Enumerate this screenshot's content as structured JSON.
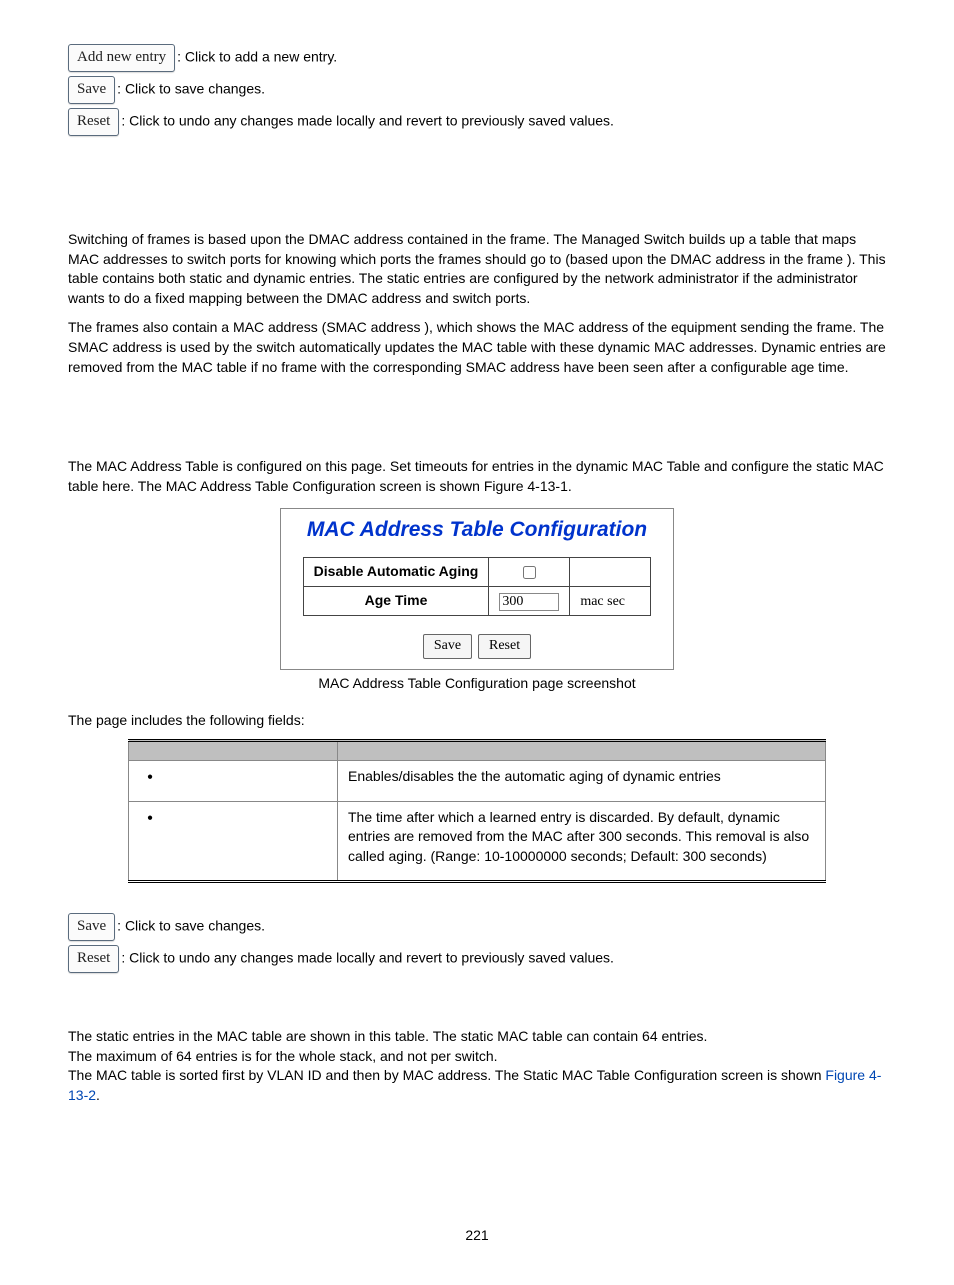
{
  "top_buttons": {
    "add_label": "Add new entry",
    "add_desc": ": Click to add a new entry.",
    "save_label": "Save",
    "save_desc": ": Click to save changes.",
    "reset_label": "Reset",
    "reset_desc": ": Click to undo any changes made locally and revert to previously saved values."
  },
  "para1": "Switching of frames is based upon the DMAC address contained in the frame. The Managed Switch builds up a table that maps MAC addresses to switch ports for knowing which ports the frames should go to (based upon the DMAC address in the frame ). This table contains both static and dynamic entries. The static entries are configured by the network administrator if the administrator wants to do a fixed mapping between the DMAC address and switch ports.",
  "para2": "The frames also contain a MAC address (SMAC address ), which shows the MAC address of the equipment sending the frame. The SMAC address is used by the switch automatically updates the MAC table with these dynamic MAC addresses. Dynamic entries are removed from the MAC table if no frame with the corresponding SMAC address have been seen after a configurable age time.",
  "para3": "The MAC Address Table is configured on this page. Set timeouts for entries in the dynamic MAC Table and configure the static MAC table here. The MAC Address Table Configuration screen is shown Figure 4-13-1.",
  "figure": {
    "title": "MAC Address Table Configuration",
    "row1_label": "Disable Automatic Aging",
    "row2_label": "Age Time",
    "age_value": "300",
    "age_unit": "mac sec",
    "save_label": "Save",
    "reset_label": "Reset"
  },
  "fig_caption": "MAC Address Table Configuration page screenshot",
  "fields_intro": "The page includes the following fields:",
  "fields": {
    "row1_desc": "Enables/disables the the automatic aging of dynamic entries",
    "row2_desc": "The time after which a learned entry is discarded. By default, dynamic entries are removed from the MAC after 300 seconds. This removal is also called aging. (Range: 10-10000000 seconds; Default: 300 seconds)"
  },
  "bottom_buttons": {
    "save_label": "Save",
    "save_desc": ": Click to save changes.",
    "reset_label": "Reset",
    "reset_desc": ": Click to undo any changes made locally and revert to previously saved values."
  },
  "static_p1": "The static entries in the MAC table are shown in this table. The static MAC table can contain 64 entries.",
  "static_p2": "The maximum of 64 entries is for the whole stack, and not per switch.",
  "static_p3a": "The MAC table is sorted first by VLAN ID and then by MAC address. The Static MAC Table Configuration screen is shown ",
  "static_link": "Figure 4-13-2",
  "static_p3b": ".",
  "page_number": "221"
}
